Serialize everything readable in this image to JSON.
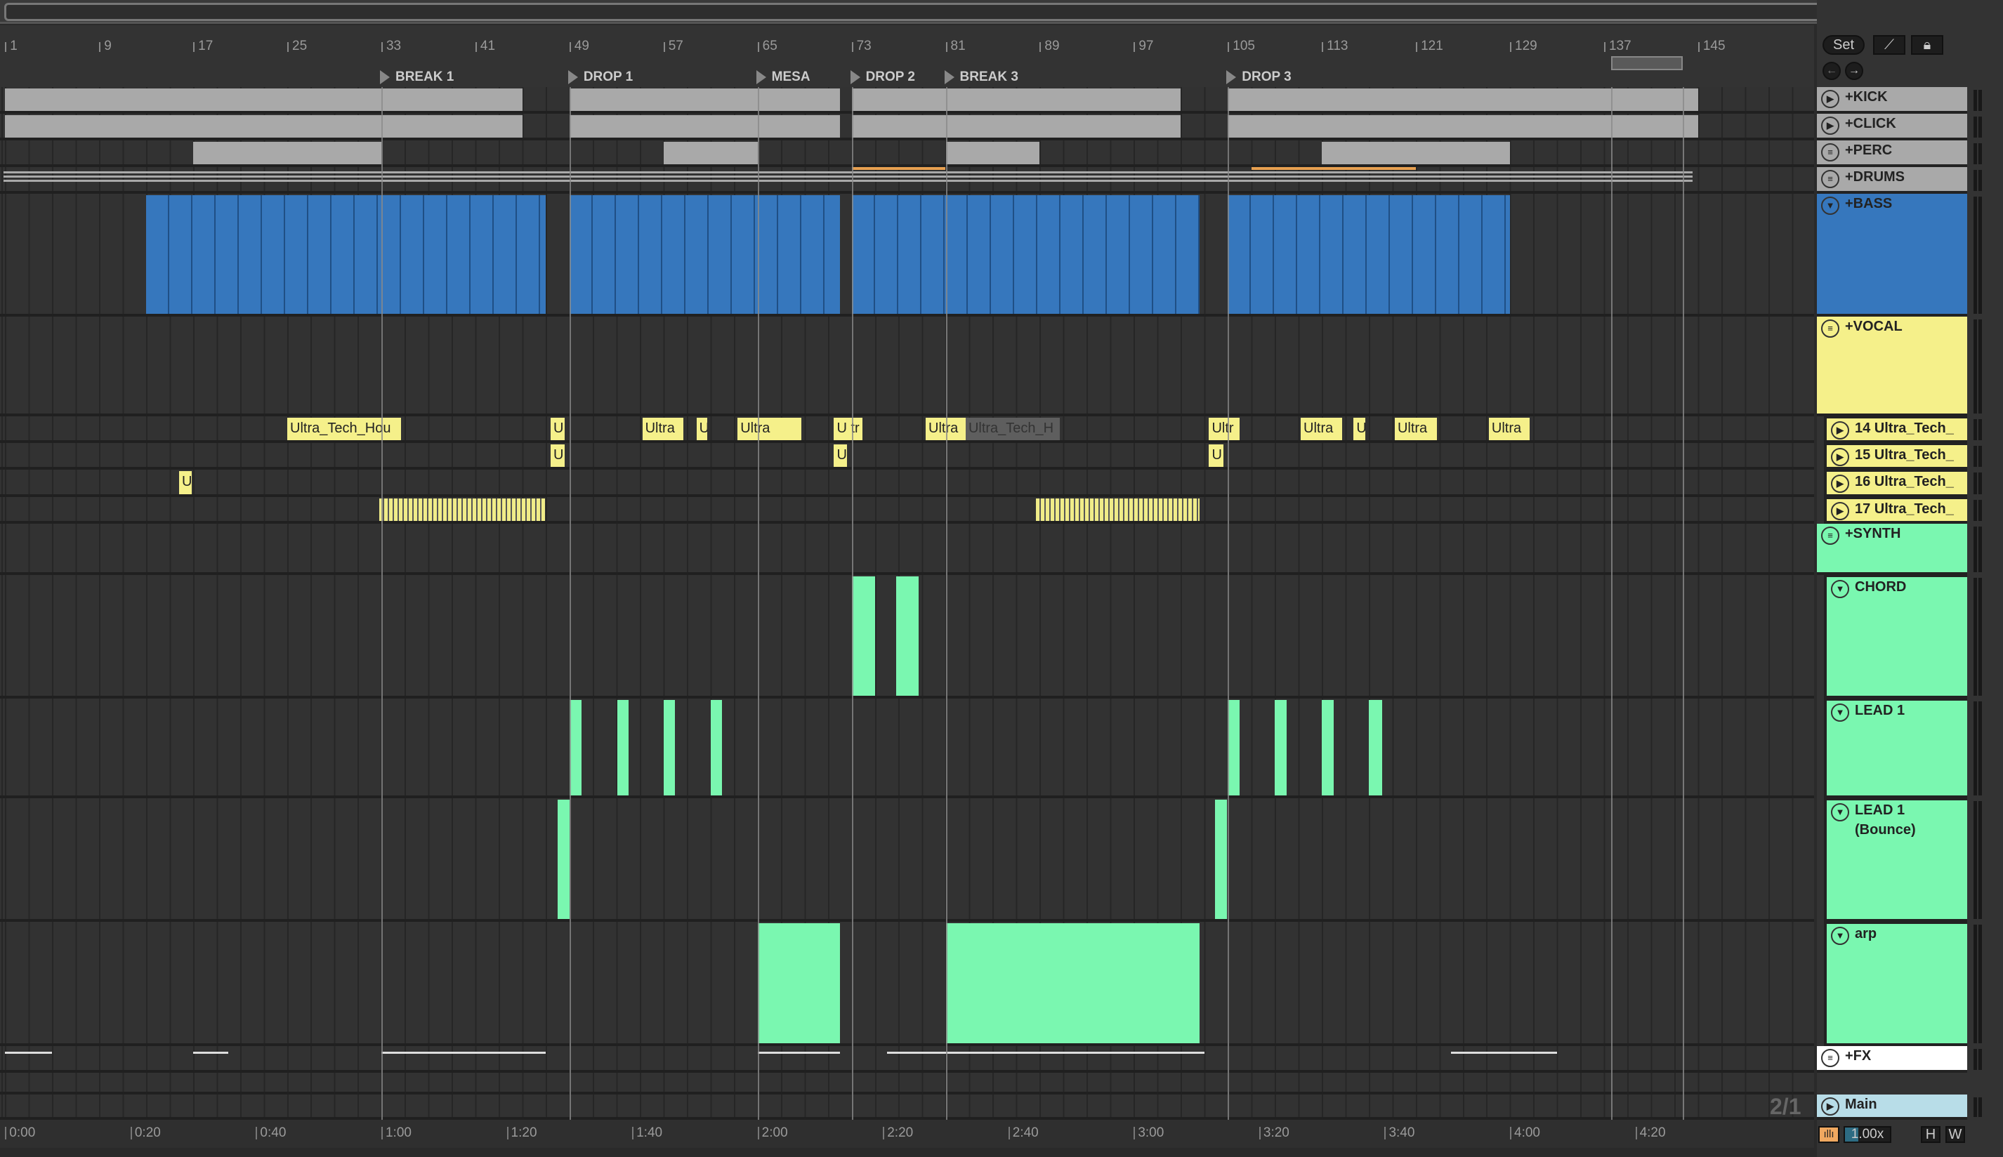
{
  "ruler": {
    "bars": [
      1,
      9,
      17,
      25,
      33,
      41,
      49,
      57,
      65,
      73,
      81,
      89,
      97,
      105,
      113,
      121,
      129,
      137,
      145
    ]
  },
  "locators": [
    {
      "label": "BREAK 1",
      "bar": 33
    },
    {
      "label": "DROP 1",
      "bar": 49
    },
    {
      "label": "MESA",
      "bar": 65
    },
    {
      "label": "DROP 2",
      "bar": 73
    },
    {
      "label": "BREAK 3",
      "bar": 81
    },
    {
      "label": "DROP 3",
      "bar": 105
    }
  ],
  "loop": {
    "start": 137.6,
    "end": 143.7
  },
  "time_labels": [
    "0:00",
    "0:20",
    "0:40",
    "1:00",
    "1:20",
    "1:40",
    "2:00",
    "2:20",
    "2:40",
    "3:00",
    "3:20",
    "3:40",
    "4:00",
    "4:20"
  ],
  "controls": {
    "set_label": "Set",
    "zoom_label": "1.00x",
    "h_label": "H",
    "w_label": "W",
    "page_label": "2/1"
  },
  "colors": {
    "grey": "#a9a9a9",
    "blue": "#3677bd",
    "yellow": "#f5f08a",
    "green": "#7af7b0",
    "olive": "#f0ec88",
    "white": "#ffffff",
    "main": "#b8dde8"
  },
  "tracks": [
    {
      "name": "+KICK",
      "icon": "play",
      "color": "#a9a9a9",
      "clips": [
        [
          1,
          45
        ],
        [
          49,
          72
        ],
        [
          73,
          101
        ],
        [
          105,
          145
        ]
      ]
    },
    {
      "name": "+CLICK",
      "icon": "play",
      "color": "#a9a9a9",
      "clips": [
        [
          1,
          45
        ],
        [
          49,
          72
        ],
        [
          73,
          101
        ],
        [
          105,
          145
        ]
      ]
    },
    {
      "name": "+PERC",
      "icon": "menu",
      "color": "#a9a9a9",
      "clips": [
        [
          17,
          33
        ],
        [
          57,
          65
        ],
        [
          81,
          89
        ],
        [
          113,
          129
        ]
      ]
    },
    {
      "name": "+DRUMS",
      "icon": "menu",
      "color": "#a9a9a9",
      "clips": []
    },
    {
      "name": "+BASS",
      "icon": "fold",
      "color": "#3677bd",
      "clips": [
        [
          13,
          47
        ],
        [
          49,
          72
        ],
        [
          73,
          102.6
        ],
        [
          105,
          129
        ]
      ]
    },
    {
      "name": "+VOCAL",
      "icon": "menu",
      "color": "#f5f08a",
      "clips": []
    },
    {
      "name": "14 Ultra_Tech_",
      "icon": "play",
      "color": "#f5f08a",
      "nested": true,
      "clips": [
        [
          25,
          34.7,
          "Ultra_Tech_Hou"
        ],
        [
          47.4,
          48.6,
          "U"
        ],
        [
          55.2,
          58.7,
          "Ultra"
        ],
        [
          59.8,
          60.7,
          "U"
        ],
        [
          63.3,
          68.7,
          "Ultra"
        ],
        [
          71.5,
          73.9,
          "U tr"
        ],
        [
          79.3,
          82.7,
          "Ultra"
        ],
        [
          82.7,
          90.7,
          "Ultra_Tech_H",
          "grey"
        ],
        [
          103.4,
          106,
          "Ultr"
        ],
        [
          111.2,
          114.7,
          "Ultra"
        ],
        [
          115.7,
          116.7,
          "U"
        ],
        [
          119.2,
          122.8,
          "Ultra"
        ],
        [
          127.2,
          130.7,
          "Ultra"
        ]
      ]
    },
    {
      "name": "15 Ultra_Tech_",
      "icon": "play",
      "color": "#f5f08a",
      "nested": true,
      "clips": [
        [
          47.4,
          48.6,
          "U"
        ],
        [
          71.5,
          72.6,
          "U"
        ],
        [
          103.4,
          104.6,
          "U"
        ]
      ]
    },
    {
      "name": "16 Ultra_Tech_",
      "icon": "play",
      "color": "#f5f08a",
      "nested": true,
      "clips": [
        [
          15.8,
          16.9,
          "U"
        ]
      ]
    },
    {
      "name": "17 Ultra_Tech_",
      "icon": "play",
      "color": "#f5f08a",
      "nested": true,
      "clips": [
        [
          32.8,
          46.9,
          "",
          "stripe"
        ],
        [
          88.7,
          102.6,
          "",
          "stripe"
        ]
      ]
    },
    {
      "name": "+SYNTH",
      "icon": "menu",
      "color": "#7af7b0",
      "clips": []
    },
    {
      "name": "CHORD",
      "icon": "fold",
      "color": "#7af7b0",
      "nested": true,
      "clips": [
        [
          73,
          75
        ],
        [
          76.8,
          78.7
        ]
      ]
    },
    {
      "name": "LEAD 1",
      "icon": "fold",
      "color": "#7af7b0",
      "nested": true,
      "clips": [
        [
          49,
          50
        ],
        [
          53.1,
          54
        ],
        [
          57,
          58
        ],
        [
          61,
          62
        ],
        [
          105,
          106
        ],
        [
          109,
          110
        ],
        [
          113,
          114
        ],
        [
          117,
          118.1
        ]
      ]
    },
    {
      "name": "LEAD 1 (Bounce)",
      "icon": "fold",
      "color": "#7af7b0",
      "nested": true,
      "clips": [
        [
          48,
          49
        ],
        [
          103.9,
          104.9
        ]
      ]
    },
    {
      "name": "arp",
      "icon": "fold",
      "color": "#7af7b0",
      "nested": true,
      "clips": [
        [
          65,
          72
        ],
        [
          81,
          102.6
        ]
      ]
    },
    {
      "name": "+FX",
      "icon": "menu",
      "color": "#ffffff",
      "clips": []
    },
    {
      "name": "",
      "icon": "",
      "color": "",
      "clips": []
    },
    {
      "name": "Main",
      "icon": "play",
      "color": "#b8dde8",
      "clips": []
    }
  ]
}
